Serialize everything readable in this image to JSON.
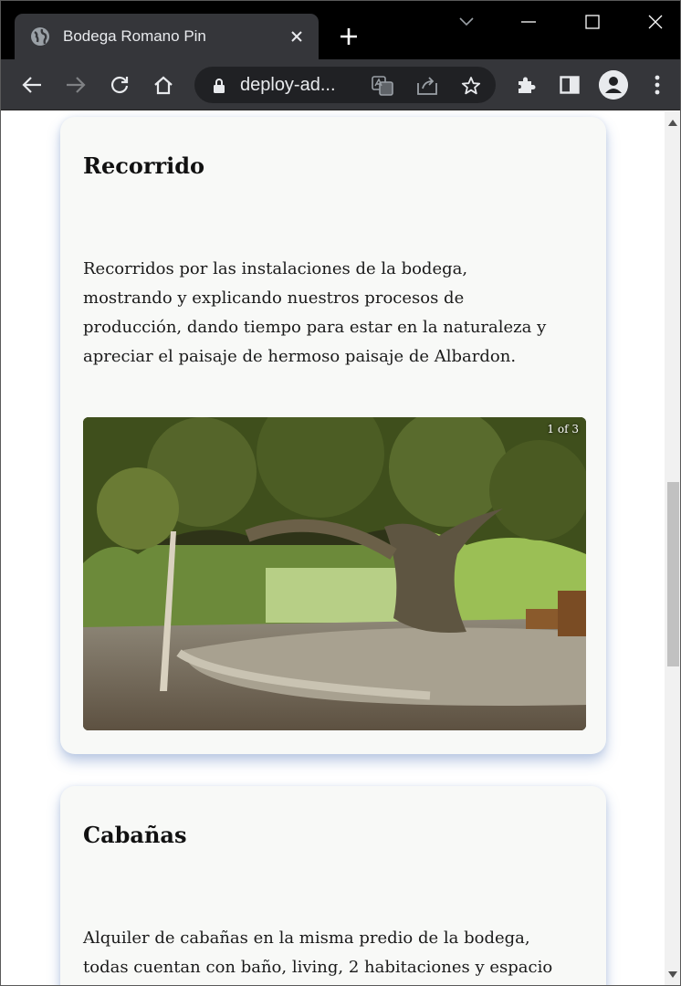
{
  "browser": {
    "tab_title": "Bodega Romano Pin",
    "url": "deploy-ad..."
  },
  "cards": [
    {
      "title": "Recorrido",
      "text": "Recorridos por las instalaciones de la bodega, mostrando y explicando nuestros procesos de producción, dando tiempo para estar en la naturaleza y apreciar el paisaje de hermoso paisaje de Albardon.",
      "carousel_counter": "1 of 3"
    },
    {
      "title": "Cabañas",
      "text": "Alquiler de cabañas en la misma predio de la bodega, todas cuentan con baño, living, 2 habitaciones y espacio"
    }
  ],
  "colors": {
    "tab_bg": "#35363a",
    "strip_bg": "#000000",
    "card_bg": "#f8f9f7"
  }
}
